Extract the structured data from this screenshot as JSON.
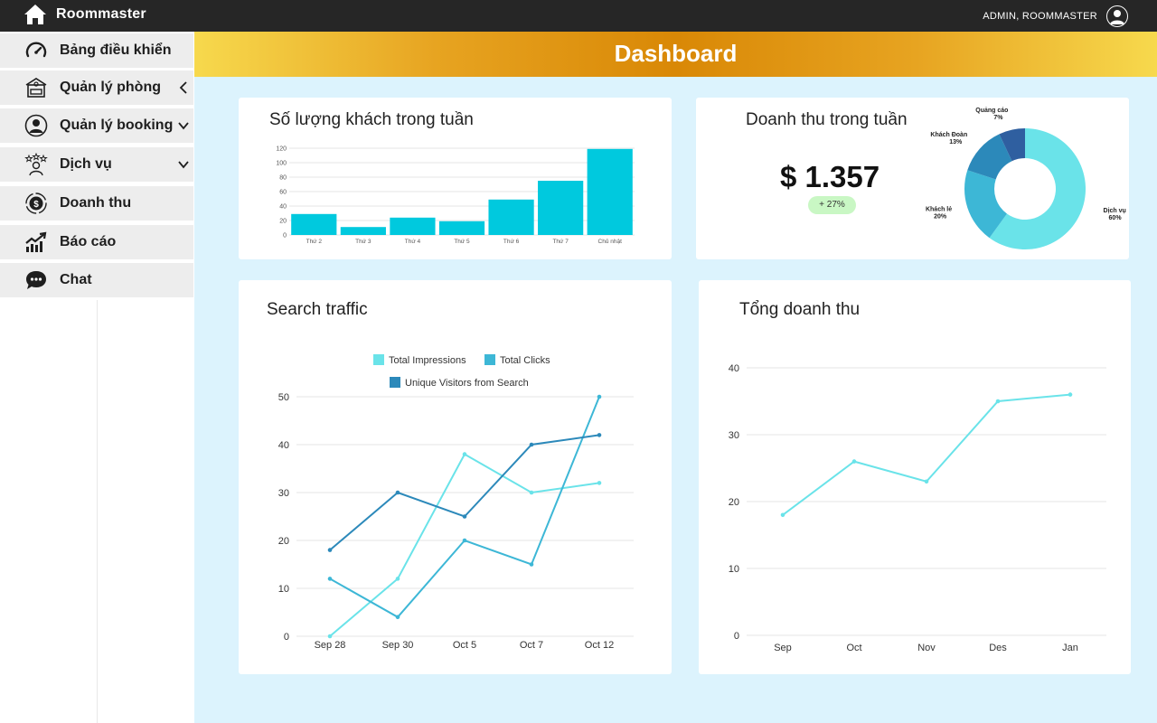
{
  "app": {
    "name": "Roommaster",
    "user": "ADMIN, ROOMMASTER"
  },
  "sidebar": {
    "items": [
      {
        "label": "Bảng điều khiển",
        "icon": "speedometer-icon"
      },
      {
        "label": "Quản lý phòng",
        "icon": "room-icon",
        "chevron": "left"
      },
      {
        "label": "Quản lý booking",
        "icon": "user-circle-icon",
        "chevron": "down"
      },
      {
        "label": "Dịch vụ",
        "icon": "service-star-icon",
        "chevron": "down"
      },
      {
        "label": "Doanh thu",
        "icon": "dollar-coin-icon"
      },
      {
        "label": "Báo cáo",
        "icon": "report-chart-icon"
      },
      {
        "label": "Chat",
        "icon": "chat-bubble-icon"
      }
    ]
  },
  "header": {
    "title": "Dashboard"
  },
  "cards": {
    "guests": {
      "title": "Số lượng khách trong tuần"
    },
    "revenue_week": {
      "title": "Doanh thu trong tuần",
      "amount": "$ 1.357",
      "growth": "+ 27%"
    },
    "search": {
      "title": "Search traffic"
    },
    "total_revenue": {
      "title": "Tổng doanh thu"
    }
  },
  "colors": {
    "bar": "#00c9de",
    "impressions": "#6ae3e9",
    "clicks": "#3db7d6",
    "visitors": "#2c89ba",
    "pie_dark": "#2f5fa0"
  },
  "chart_data": [
    {
      "id": "guests",
      "type": "bar",
      "categories": [
        "Thứ 2",
        "Thứ 3",
        "Thứ 4",
        "Thứ 5",
        "Thứ 6",
        "Thứ 7",
        "Chủ nhật"
      ],
      "values": [
        29,
        11,
        24,
        19,
        49,
        75,
        119
      ],
      "ylim": [
        0,
        120
      ],
      "yticks": [
        0,
        20,
        40,
        60,
        80,
        100,
        120
      ],
      "grid": true
    },
    {
      "id": "revenue_pie",
      "type": "pie",
      "donut": true,
      "slices": [
        {
          "label": "Dịch vụ",
          "value": 60,
          "display": "60%"
        },
        {
          "label": "Khách lẻ",
          "value": 20,
          "display": "20%"
        },
        {
          "label": "Khách Đoàn",
          "value": 13,
          "display": "13%"
        },
        {
          "label": "Quảng cáo",
          "value": 7,
          "display": "7%"
        }
      ]
    },
    {
      "id": "search_traffic",
      "type": "line",
      "categories": [
        "Sep 28",
        "Sep 30",
        "Oct 5",
        "Oct 7",
        "Oct 12"
      ],
      "series": [
        {
          "name": "Total Impressions",
          "values": [
            0,
            12,
            38,
            30,
            32
          ]
        },
        {
          "name": "Total Clicks",
          "values": [
            12,
            4,
            20,
            15,
            50
          ]
        },
        {
          "name": "Unique Visitors from Search",
          "values": [
            18,
            30,
            25,
            40,
            42
          ]
        }
      ],
      "ylim": [
        0,
        50
      ],
      "yticks": [
        0,
        10,
        20,
        30,
        40,
        50
      ],
      "legend": "top",
      "grid": true
    },
    {
      "id": "total_revenue",
      "type": "line",
      "categories": [
        "Sep",
        "Oct",
        "Nov",
        "Des",
        "Jan"
      ],
      "values": [
        18,
        26,
        23,
        35,
        36
      ],
      "ylim": [
        0,
        40
      ],
      "yticks": [
        0,
        10,
        20,
        30,
        40
      ],
      "grid": true
    }
  ]
}
